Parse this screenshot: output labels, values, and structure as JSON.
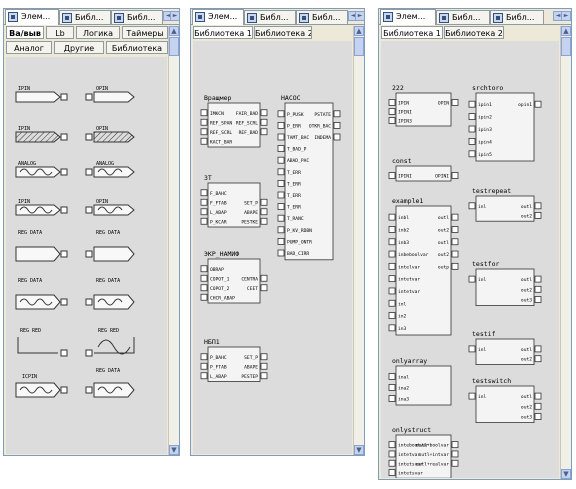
{
  "panel1": {
    "tabs": [
      "Элем...",
      "Библ...",
      "Библ..."
    ],
    "lib_tabs_row1": [
      "Ва/выв",
      "Lb",
      "Логика",
      "Таймеры"
    ],
    "lib_tabs_row2": [
      "Аналог",
      "Другие",
      "Библиотека"
    ],
    "items": [
      {
        "left": "IPIN",
        "right": "OPIN"
      },
      {
        "left": "IPIN",
        "right": "OPIN"
      },
      {
        "left": "ANALOG",
        "right": "ANALOG"
      },
      {
        "left": "IPIN",
        "right": "OPIN"
      },
      {
        "left": "REG DATA",
        "right": "REG DATA"
      },
      {
        "left": "REG DATA",
        "right": "REG DATA"
      },
      {
        "left": "REG RED",
        "right": "REG RED"
      },
      {
        "left": "ICPIN",
        "right": "REG DATA"
      }
    ]
  },
  "panel2": {
    "tabs": [
      "Элем...",
      "Библ...",
      "Библ..."
    ],
    "lib_tabs": [
      "Библиотека 1",
      "Библиотека 2"
    ],
    "blocks": [
      {
        "title": "Вращмер",
        "inputs": [
          "IMKCN",
          "REF_SPAN",
          "REF_SCRL",
          "KACT_BAR"
        ],
        "outputs": [
          "FAIR_BAD",
          "REF_SCRL",
          "REF_BAD"
        ]
      },
      {
        "title": "НАСОС",
        "inputs": [
          "P_PUSK",
          "P_ERR",
          "TAMT_BAC",
          "T_BAD_P",
          "ABAD_PAC",
          "T_ERR",
          "T_ERR",
          "T_ERR",
          "T_ERR",
          "T_RANC",
          "P_KV_RDBN",
          "PUMP_ONTR",
          "BAD_CIRR"
        ],
        "outputs": [
          "PSTATE",
          "OTKR_BAC",
          "INDEMA"
        ]
      },
      {
        "title": "ЗТ",
        "inputs": [
          "F_BAHC",
          "F_FTAB",
          "L_ABAP",
          "P_KCAR"
        ],
        "outputs": [
          "SET_P",
          "ABAPE",
          "PESTKE"
        ]
      },
      {
        "title": "ЭКР_НАМИФ",
        "inputs": [
          "OBRAP",
          "COPOT_1",
          "COPOT_2",
          "CHCR_ABAP"
        ],
        "outputs": [
          "CENTRA",
          "CEET"
        ]
      },
      {
        "title": "НБП1",
        "inputs": [
          "P_BAHC",
          "P_FTAB",
          "L_ABAP"
        ],
        "outputs": [
          "SET_P",
          "ABAPE",
          "PESTEP"
        ]
      }
    ]
  },
  "panel3": {
    "tabs": [
      "Элем...",
      "Библ...",
      "Библ..."
    ],
    "lib_tabs": [
      "Библиотека 1",
      "Библиотека 2"
    ],
    "blocks": [
      {
        "title": "222",
        "inputs": [
          "IPIN",
          "IPINI",
          "IPIN3"
        ],
        "outputs": [
          "OPIN"
        ]
      },
      {
        "title": "srchtoro",
        "inputs": [
          "ipin1",
          "ipin2",
          "ipin3",
          "ipin4",
          "ipin5"
        ],
        "outputs": [
          "opin1"
        ]
      },
      {
        "title": "const",
        "inputs": [
          "IPINI"
        ],
        "outputs": [
          "OPINI"
        ]
      },
      {
        "title": "testrepeat",
        "inputs": [
          "inl"
        ],
        "outputs": [
          "outl",
          "out2"
        ]
      },
      {
        "title": "example1",
        "inputs": [
          "inbl",
          "inb2",
          "inb3",
          "inbeboolvar",
          "intelvar",
          "intetvar",
          "intetvar",
          "inl",
          "in2",
          "in3"
        ],
        "outputs": [
          "outl",
          "out2",
          "outl",
          "out2",
          "outp"
        ]
      },
      {
        "title": "testfor",
        "inputs": [
          "inl"
        ],
        "outputs": [
          "outl",
          "out2",
          "out3"
        ]
      },
      {
        "title": "testif",
        "inputs": [
          "inl"
        ],
        "outputs": [
          "outl",
          "out2"
        ]
      },
      {
        "title": "onlyarray",
        "inputs": [
          "inal",
          "ina2",
          "ina3"
        ],
        "outputs": []
      },
      {
        "title": "testswitch",
        "inputs": [
          "inl"
        ],
        "outputs": [
          "outl",
          "out2",
          "out3"
        ]
      },
      {
        "title": "onlystruct",
        "inputs": [
          "intebootvar",
          "intetvar",
          "intetsvar",
          "intetsvar"
        ],
        "outputs": [
          "outl+boolvar",
          "outl+intvar",
          "outl+realvar"
        ]
      }
    ]
  }
}
